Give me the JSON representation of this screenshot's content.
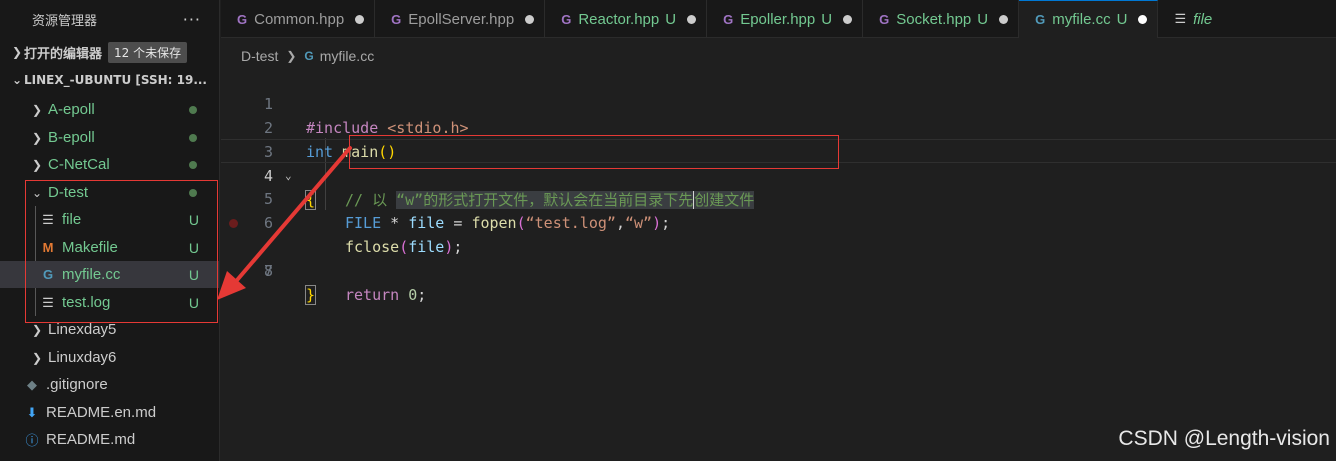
{
  "sidebar": {
    "title": "资源管理器",
    "more": "···",
    "open_editors": {
      "label": "打开的编辑器",
      "badge": "12 个未保存"
    },
    "root": {
      "label": "LINEX_-UBUNTU [SSH: 19..."
    },
    "items": [
      {
        "label": "A-epoll"
      },
      {
        "label": "B-epoll"
      },
      {
        "label": "C-NetCal"
      },
      {
        "label": "D-test"
      },
      {
        "label": "file",
        "status": "U"
      },
      {
        "label": "Makefile",
        "status": "U"
      },
      {
        "label": "myfile.cc",
        "status": "U"
      },
      {
        "label": "test.log",
        "status": "U"
      },
      {
        "label": "Linexday5"
      },
      {
        "label": "Linuxday6"
      },
      {
        "label": ".gitignore"
      },
      {
        "label": "README.en.md"
      },
      {
        "label": "README.md"
      }
    ]
  },
  "tabs": [
    {
      "label": "Common.hpp"
    },
    {
      "label": "EpollServer.hpp"
    },
    {
      "label": "Reactor.hpp",
      "status": "U"
    },
    {
      "label": "Epoller.hpp",
      "status": "U"
    },
    {
      "label": "Socket.hpp",
      "status": "U"
    },
    {
      "label": "myfile.cc",
      "status": "U"
    },
    {
      "label": "file"
    }
  ],
  "breadcrumb": {
    "folder": "D-test",
    "file": "myfile.cc"
  },
  "editor": {
    "line_numbers": [
      "1",
      "2",
      "3",
      "4",
      "5",
      "6",
      "7",
      "8"
    ],
    "tokens": {
      "l1_kw": "#include",
      "l1_str": " <stdio.h>",
      "l2_ty": "int",
      "l2_fn": " main",
      "l2_par": "()",
      "l3_brace": "{",
      "l4_a": "// 以 ",
      "l4_b": "“w”",
      "l4_c": "的形式打开文件，默认会在当前目录下先",
      "l4_d": "创建文件",
      "l5_ty": "FILE",
      "l5_op": " * ",
      "l5_var": "file",
      "l5_eq": " = ",
      "l5_fn": "fopen",
      "l5_p1": "(",
      "l5_s1": "“test.log”",
      "l5_comma": ",",
      "l5_s2": "“w”",
      "l5_p2": ")",
      "l5_semi": ";",
      "l6_fn": "fclose",
      "l6_p1": "(",
      "l6_var": "file",
      "l6_p2": ")",
      "l6_semi": ";",
      "l7_kw": "return",
      "l7_num": " 0",
      "l7_semi": ";",
      "l8_brace": "}"
    }
  },
  "watermark": "CSDN @Length-vision",
  "colors": {
    "untracked": "#73c991",
    "annotation": "#e53935",
    "accent": "#0078d4"
  }
}
